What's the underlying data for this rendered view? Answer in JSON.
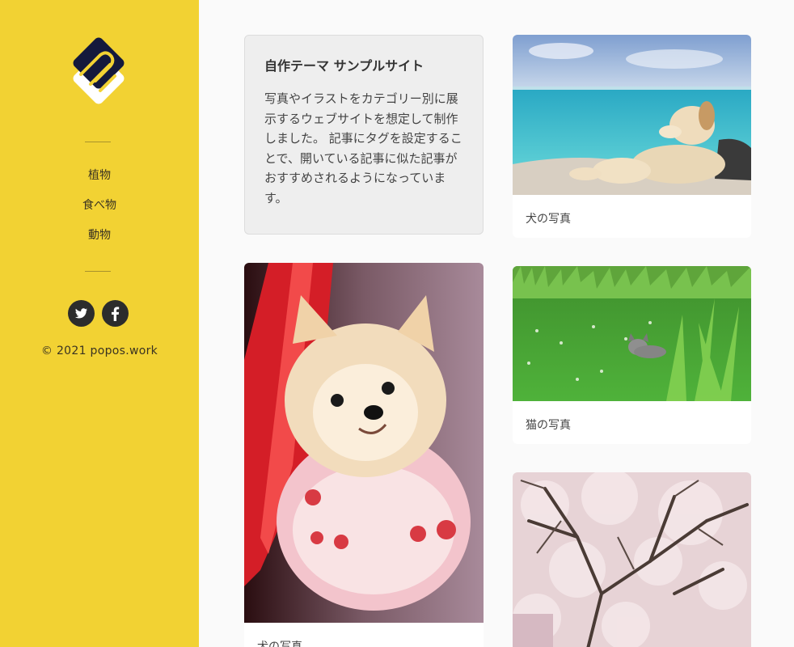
{
  "sidebar": {
    "nav": [
      "植物",
      "食べ物",
      "動物"
    ],
    "copyright": "© 2021 popos.work",
    "social": [
      "twitter-icon",
      "facebook-icon"
    ]
  },
  "intro": {
    "title": "自作テーマ サンプルサイト",
    "body": "写真やイラストをカテゴリー別に展示するウェブサイトを想定して制作しました。 記事にタグを設定することで、開いている記事に似た記事がおすすめされるようになっています。"
  },
  "cards": [
    {
      "caption": "犬の写真"
    },
    {
      "caption": "猫の写真"
    },
    {
      "caption": "犬の写真"
    }
  ],
  "colors": {
    "sidebar": "#f2d233",
    "logo": "#14193c",
    "background": "#fafafa"
  }
}
